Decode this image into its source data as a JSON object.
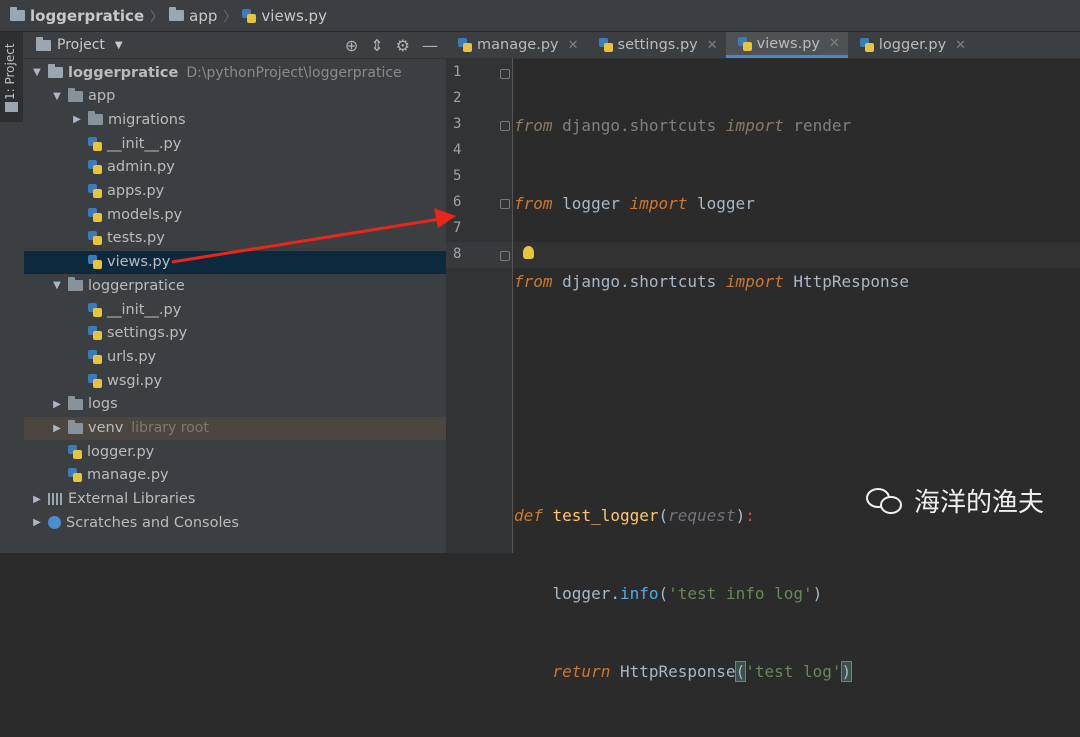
{
  "breadcrumb": {
    "project": "loggerpratice",
    "folder": "app",
    "file": "views.py"
  },
  "side_strip": {
    "tab_label": "1: Project"
  },
  "project_panel": {
    "title": "Project",
    "tree": [
      {
        "label": "loggerpratice",
        "hint": "D:\\pythonProject\\loggerpratice",
        "type": "folder",
        "expanded": true,
        "depth": 0
      },
      {
        "label": "app",
        "type": "folder",
        "expanded": true,
        "depth": 1
      },
      {
        "label": "migrations",
        "type": "folder",
        "expanded": false,
        "depth": 2
      },
      {
        "label": "__init__.py",
        "type": "py",
        "depth": 2
      },
      {
        "label": "admin.py",
        "type": "py",
        "depth": 2
      },
      {
        "label": "apps.py",
        "type": "py",
        "depth": 2
      },
      {
        "label": "models.py",
        "type": "py",
        "depth": 2
      },
      {
        "label": "tests.py",
        "type": "py",
        "depth": 2
      },
      {
        "label": "views.py",
        "type": "py",
        "depth": 2,
        "selected": true
      },
      {
        "label": "loggerpratice",
        "type": "folder",
        "expanded": true,
        "depth": 1
      },
      {
        "label": "__init__.py",
        "type": "py",
        "depth": 2
      },
      {
        "label": "settings.py",
        "type": "py",
        "depth": 2
      },
      {
        "label": "urls.py",
        "type": "py",
        "depth": 2
      },
      {
        "label": "wsgi.py",
        "type": "py",
        "depth": 2
      },
      {
        "label": "logs",
        "type": "folder",
        "expanded": false,
        "depth": 1
      },
      {
        "label": "venv",
        "hint": "library root",
        "type": "folder",
        "expanded": false,
        "depth": 1,
        "venv": true
      },
      {
        "label": "logger.py",
        "type": "py",
        "depth": 1
      },
      {
        "label": "manage.py",
        "type": "py",
        "depth": 1
      },
      {
        "label": "External Libraries",
        "type": "lib",
        "expanded": false,
        "depth": 0
      },
      {
        "label": "Scratches and Consoles",
        "type": "scratch",
        "expanded": false,
        "depth": 0
      }
    ]
  },
  "editor": {
    "tabs": [
      {
        "label": "manage.py",
        "active": false
      },
      {
        "label": "settings.py",
        "active": false
      },
      {
        "label": "views.py",
        "active": true
      },
      {
        "label": "logger.py",
        "active": false
      }
    ],
    "line_numbers": [
      "1",
      "2",
      "3",
      "4",
      "5",
      "6",
      "7",
      "8"
    ],
    "code": {
      "l1_from": "from",
      "l1_mod": " django.shortcuts ",
      "l1_import": "import",
      "l1_name": " render",
      "l2_from": "from",
      "l2_mod": " logger ",
      "l2_import": "import",
      "l2_name": " logger",
      "l3_from": "from",
      "l3_mod": " django.shortcuts ",
      "l3_import": "import",
      "l3_name": " HttpResponse",
      "l6_def": "def",
      "l6_fn": " test_logger",
      "l6_open": "(",
      "l6_param": "request",
      "l6_close": ")",
      "l6_colon": ":",
      "l7_obj": "    logger.",
      "l7_meth": "info",
      "l7_open": "(",
      "l7_str": "'test info log'",
      "l7_close": ")",
      "l8_indent": "    ",
      "l8_ret": "return",
      "l8_cls": " HttpResponse",
      "l8_open": "(",
      "l8_str": "'test log'",
      "l8_close": ")"
    }
  },
  "watermark": {
    "text": "海洋的渔夫"
  },
  "colors": {
    "background": "#2b2b2b",
    "panel": "#3c3f41",
    "selection": "#0d293e",
    "keyword": "#cc7832",
    "string": "#6a8759",
    "function": "#ffc66d",
    "arrow": "#e8261c"
  }
}
